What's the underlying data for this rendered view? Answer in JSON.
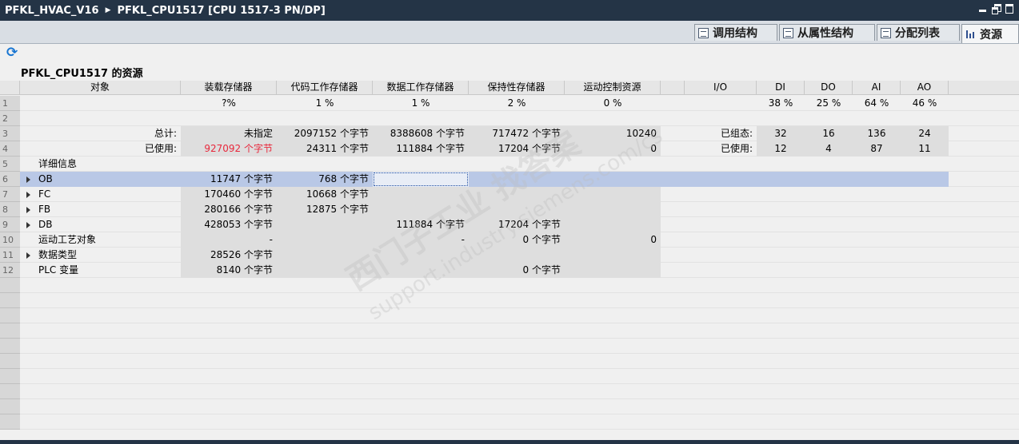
{
  "title": {
    "project": "PFKL_HVAC_V16",
    "device": "PFKL_CPU1517 [CPU 1517-3 PN/DP]"
  },
  "tabs": [
    {
      "label": "调用结构",
      "icon": "call-structure-icon"
    },
    {
      "label": "从属性结构",
      "icon": "dependency-structure-icon"
    },
    {
      "label": "分配列表",
      "icon": "assignment-list-icon"
    },
    {
      "label": "资源",
      "icon": "resources-icon",
      "active": true
    }
  ],
  "section_title": "PFKL_CPU1517 的资源",
  "headers": [
    "对象",
    "装载存储器",
    "代码工作存储器",
    "数据工作存储器",
    "保持性存储器",
    "运动控制资源",
    "",
    "I/O",
    "DI",
    "DO",
    "AI",
    "AO"
  ],
  "row_numbers": [
    "1",
    "2",
    "3",
    "4",
    "5",
    "6",
    "7",
    "8",
    "9",
    "10",
    "11",
    "12"
  ],
  "row1": {
    "load": "?%",
    "code": "1 %",
    "data": "1 %",
    "retain": "2 %",
    "motion": "0 %",
    "di": "38 %",
    "do": "25 %",
    "ai": "64 %",
    "ao": "46 %"
  },
  "row3": {
    "label": "总计:",
    "load": "未指定",
    "code": "2097152 个字节",
    "data": "8388608 个字节",
    "retain": "717472 个字节",
    "motion": "10240",
    "io_label": "已组态:",
    "di": "32",
    "do": "16",
    "ai": "136",
    "ao": "24"
  },
  "row4": {
    "label": "已使用:",
    "load": "927092 个字节",
    "code": "24311 个字节",
    "data": "111884 个字节",
    "retain": "17204 个字节",
    "motion": "0",
    "io_label": "已使用:",
    "di": "12",
    "do": "4",
    "ai": "87",
    "ao": "11"
  },
  "row5": {
    "label": "详细信息"
  },
  "details": [
    {
      "name": "OB",
      "load": "11747 个字节",
      "code": "768 个字节",
      "data": "",
      "retain": "",
      "motion": ""
    },
    {
      "name": "FC",
      "load": "170460 个字节",
      "code": "10668 个字节",
      "data": "",
      "retain": "",
      "motion": ""
    },
    {
      "name": "FB",
      "load": "280166 个字节",
      "code": "12875 个字节",
      "data": "",
      "retain": "",
      "motion": ""
    },
    {
      "name": "DB",
      "load": "428053 个字节",
      "code": "",
      "data": "111884 个字节",
      "retain": "17204 个字节",
      "motion": ""
    },
    {
      "name": "运动工艺对象",
      "load": "-",
      "code": "",
      "data": "-",
      "retain": "0 个字节",
      "motion": "0"
    },
    {
      "name": "数据类型",
      "load": "28526 个字节",
      "code": "",
      "data": "",
      "retain": "",
      "motion": ""
    },
    {
      "name": "PLC 变量",
      "load": "8140 个字节",
      "code": "",
      "data": "",
      "retain": "0 个字节",
      "motion": ""
    }
  ],
  "watermark": {
    "line1": "西门子工业  找答案",
    "line2": "support.industry.siemens.com/cs"
  }
}
